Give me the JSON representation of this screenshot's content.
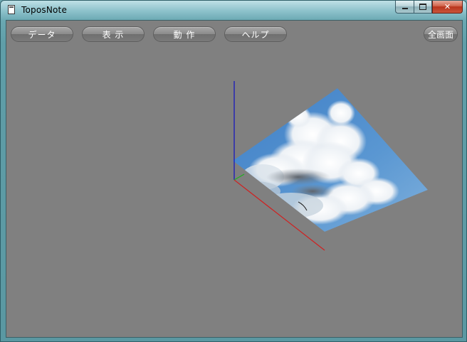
{
  "window": {
    "title": "ToposNote"
  },
  "toolbar": {
    "items": [
      {
        "label": "データ"
      },
      {
        "label": "表 示"
      },
      {
        "label": "動 作"
      },
      {
        "label": "ヘルプ"
      }
    ],
    "fullscreen_label": "全画面"
  },
  "scene": {
    "background": "#808080",
    "axis_colors": {
      "x": "#d02020",
      "y": "#20b020",
      "z": "#1010c0"
    },
    "texture": "sky-clouds",
    "sky_color": "#4a86c8"
  }
}
